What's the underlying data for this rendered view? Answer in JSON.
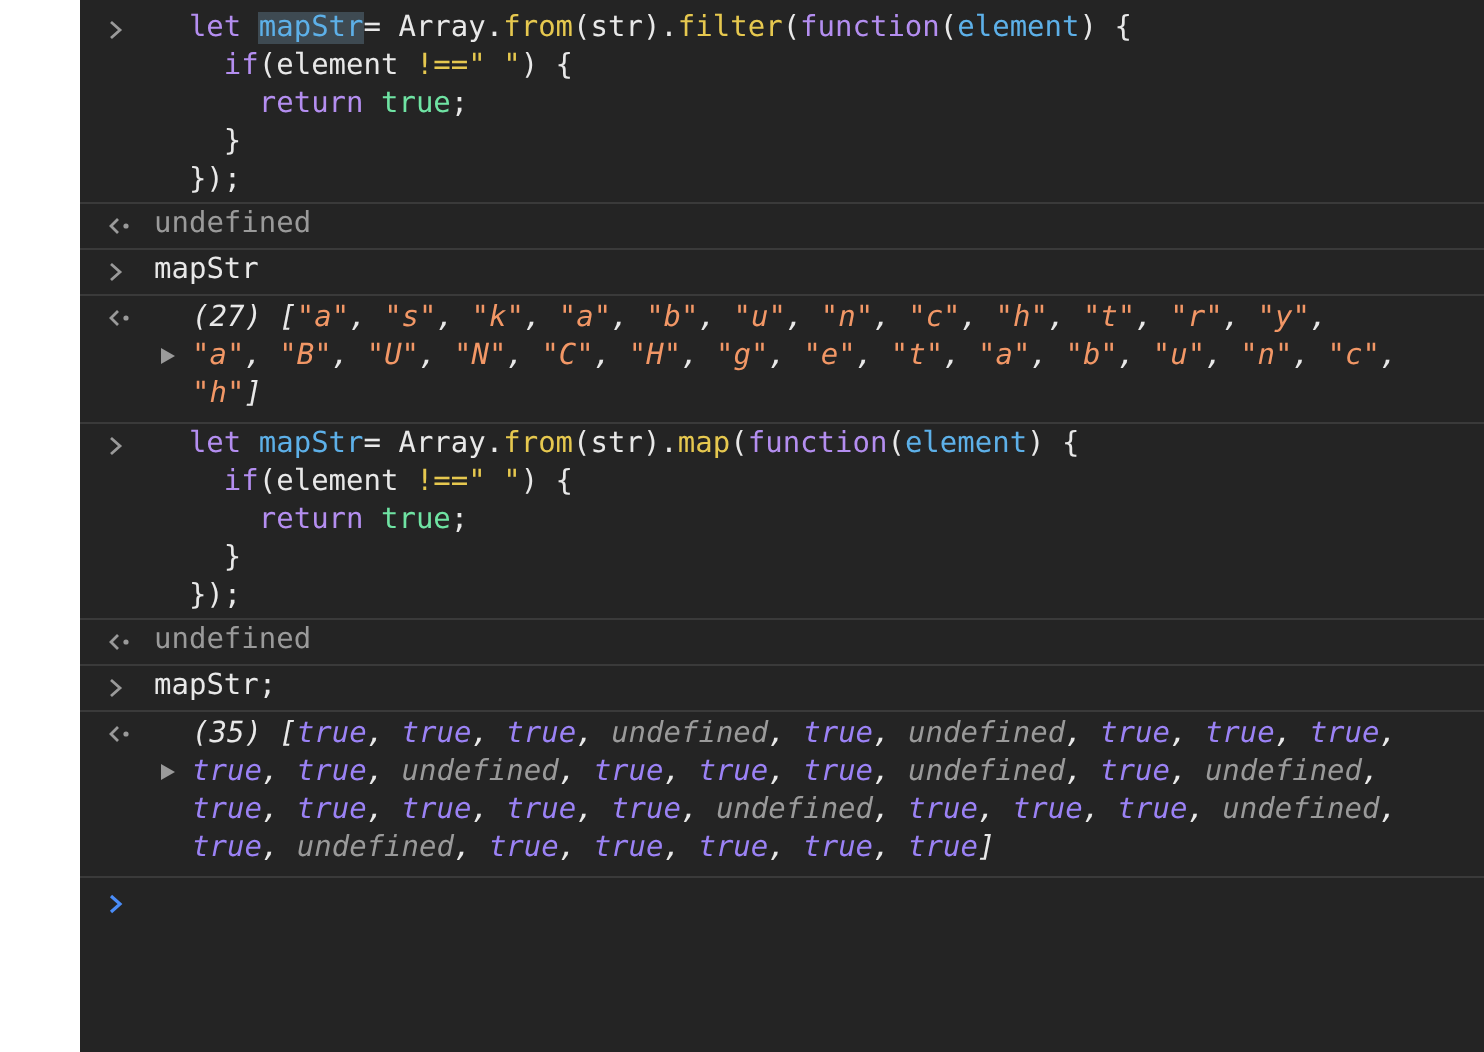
{
  "entries": [
    {
      "kind": "input",
      "lines": [
        {
          "kind": "outer",
          "tokens": [
            {
              "text": "let ",
              "kind": "keyword"
            },
            {
              "text": "mapStr",
              "kind": "highlight"
            },
            {
              "text": "= Array.",
              "kind": "plain"
            },
            {
              "text": "from",
              "kind": "method"
            },
            {
              "text": "(str).",
              "kind": "plain"
            },
            {
              "text": "filter",
              "kind": "method"
            },
            {
              "text": "(",
              "kind": "plain"
            },
            {
              "text": "function",
              "kind": "keyword"
            },
            {
              "text": "(",
              "kind": "plain"
            },
            {
              "text": "element",
              "kind": "param"
            },
            {
              "text": ") {",
              "kind": "plain"
            }
          ]
        },
        {
          "kind": "middle",
          "tokens": [
            {
              "text": "if",
              "kind": "keyword"
            },
            {
              "text": "(element ",
              "kind": "plain"
            },
            {
              "text": "!==\" \"",
              "kind": "operator"
            },
            {
              "text": ") {",
              "kind": "plain"
            }
          ]
        },
        {
          "kind": "inner",
          "tokens": [
            {
              "text": "return ",
              "kind": "keyword"
            },
            {
              "text": "true",
              "kind": "literal"
            },
            {
              "text": ";",
              "kind": "plain"
            }
          ]
        },
        {
          "kind": "middle",
          "tokens": [
            {
              "text": "}",
              "kind": "plain"
            }
          ]
        },
        {
          "kind": "outer",
          "tokens": [
            {
              "text": "});",
              "kind": "plain"
            }
          ]
        }
      ]
    },
    {
      "kind": "output",
      "text": "undefined"
    },
    {
      "kind": "input",
      "lines": [
        {
          "kind": "flush",
          "tokens": [
            {
              "text": "mapStr",
              "kind": "plain"
            }
          ]
        }
      ]
    },
    {
      "kind": "result",
      "count": "(27)",
      "open": "[",
      "close": "]",
      "separator": ", ",
      "expanded": false,
      "items": [
        {
          "text": "\"a\"",
          "kind": "string"
        },
        {
          "text": "\"s\"",
          "kind": "string"
        },
        {
          "text": "\"k\"",
          "kind": "string"
        },
        {
          "text": "\"a\"",
          "kind": "string"
        },
        {
          "text": "\"b\"",
          "kind": "string"
        },
        {
          "text": "\"u\"",
          "kind": "string"
        },
        {
          "text": "\"n\"",
          "kind": "string"
        },
        {
          "text": "\"c\"",
          "kind": "string"
        },
        {
          "text": "\"h\"",
          "kind": "string"
        },
        {
          "text": "\"t\"",
          "kind": "string"
        },
        {
          "text": "\"r\"",
          "kind": "string"
        },
        {
          "text": "\"y\"",
          "kind": "string"
        },
        {
          "text": "\"a\"",
          "kind": "string"
        },
        {
          "text": "\"B\"",
          "kind": "string"
        },
        {
          "text": "\"U\"",
          "kind": "string"
        },
        {
          "text": "\"N\"",
          "kind": "string"
        },
        {
          "text": "\"C\"",
          "kind": "string"
        },
        {
          "text": "\"H\"",
          "kind": "string"
        },
        {
          "text": "\"g\"",
          "kind": "string"
        },
        {
          "text": "\"e\"",
          "kind": "string"
        },
        {
          "text": "\"t\"",
          "kind": "string"
        },
        {
          "text": "\"a\"",
          "kind": "string"
        },
        {
          "text": "\"b\"",
          "kind": "string"
        },
        {
          "text": "\"u\"",
          "kind": "string"
        },
        {
          "text": "\"n\"",
          "kind": "string"
        },
        {
          "text": "\"c\"",
          "kind": "string"
        },
        {
          "text": "\"h\"",
          "kind": "string"
        }
      ]
    },
    {
      "kind": "input",
      "lines": [
        {
          "kind": "outer",
          "tokens": [
            {
              "text": "let ",
              "kind": "keyword"
            },
            {
              "text": "mapStr",
              "kind": "param"
            },
            {
              "text": "= Array.",
              "kind": "plain"
            },
            {
              "text": "from",
              "kind": "method"
            },
            {
              "text": "(str).",
              "kind": "plain"
            },
            {
              "text": "map",
              "kind": "method"
            },
            {
              "text": "(",
              "kind": "plain"
            },
            {
              "text": "function",
              "kind": "keyword"
            },
            {
              "text": "(",
              "kind": "plain"
            },
            {
              "text": "element",
              "kind": "param"
            },
            {
              "text": ") {",
              "kind": "plain"
            }
          ]
        },
        {
          "kind": "middle",
          "tokens": [
            {
              "text": "if",
              "kind": "keyword"
            },
            {
              "text": "(element ",
              "kind": "plain"
            },
            {
              "text": "!==\" \"",
              "kind": "operator"
            },
            {
              "text": ") {",
              "kind": "plain"
            }
          ]
        },
        {
          "kind": "inner",
          "tokens": [
            {
              "text": "return ",
              "kind": "keyword"
            },
            {
              "text": "true",
              "kind": "literal"
            },
            {
              "text": ";",
              "kind": "plain"
            }
          ]
        },
        {
          "kind": "middle",
          "tokens": [
            {
              "text": "}",
              "kind": "plain"
            }
          ]
        },
        {
          "kind": "outer",
          "tokens": [
            {
              "text": "});",
              "kind": "plain"
            }
          ]
        }
      ]
    },
    {
      "kind": "output",
      "text": "undefined"
    },
    {
      "kind": "input",
      "lines": [
        {
          "kind": "flush",
          "tokens": [
            {
              "text": "mapStr;",
              "kind": "plain"
            }
          ]
        }
      ]
    },
    {
      "kind": "result",
      "count": "(35)",
      "open": "[",
      "close": "]",
      "separator": ", ",
      "expanded": false,
      "items": [
        {
          "text": "true",
          "kind": "boolean"
        },
        {
          "text": "true",
          "kind": "boolean"
        },
        {
          "text": "true",
          "kind": "boolean"
        },
        {
          "text": "undefined",
          "kind": "undefined"
        },
        {
          "text": "true",
          "kind": "boolean"
        },
        {
          "text": "undefined",
          "kind": "undefined"
        },
        {
          "text": "true",
          "kind": "boolean"
        },
        {
          "text": "true",
          "kind": "boolean"
        },
        {
          "text": "true",
          "kind": "boolean"
        },
        {
          "text": "true",
          "kind": "boolean"
        },
        {
          "text": "true",
          "kind": "boolean"
        },
        {
          "text": "undefined",
          "kind": "undefined"
        },
        {
          "text": "true",
          "kind": "boolean"
        },
        {
          "text": "true",
          "kind": "boolean"
        },
        {
          "text": "true",
          "kind": "boolean"
        },
        {
          "text": "undefined",
          "kind": "undefined"
        },
        {
          "text": "true",
          "kind": "boolean"
        },
        {
          "text": "undefined",
          "kind": "undefined"
        },
        {
          "text": "true",
          "kind": "boolean"
        },
        {
          "text": "true",
          "kind": "boolean"
        },
        {
          "text": "true",
          "kind": "boolean"
        },
        {
          "text": "true",
          "kind": "boolean"
        },
        {
          "text": "true",
          "kind": "boolean"
        },
        {
          "text": "undefined",
          "kind": "undefined"
        },
        {
          "text": "true",
          "kind": "boolean"
        },
        {
          "text": "true",
          "kind": "boolean"
        },
        {
          "text": "true",
          "kind": "boolean"
        },
        {
          "text": "undefined",
          "kind": "undefined"
        },
        {
          "text": "true",
          "kind": "boolean"
        },
        {
          "text": "undefined",
          "kind": "undefined"
        },
        {
          "text": "true",
          "kind": "boolean"
        },
        {
          "text": "true",
          "kind": "boolean"
        },
        {
          "text": "true",
          "kind": "boolean"
        },
        {
          "text": "true",
          "kind": "boolean"
        },
        {
          "text": "true",
          "kind": "boolean"
        }
      ]
    },
    {
      "kind": "prompt"
    }
  ]
}
